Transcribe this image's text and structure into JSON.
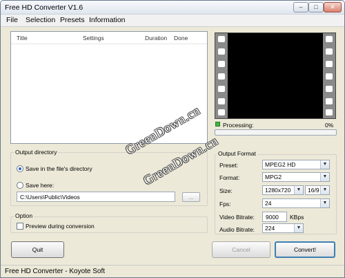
{
  "window": {
    "title": "Free HD Converter V1.6"
  },
  "menu": {
    "items": [
      "File",
      "Selection",
      "Presets",
      "Information"
    ]
  },
  "queue": {
    "columns": [
      "Title",
      "Settings",
      "Duration",
      "Done"
    ]
  },
  "preview": {
    "processing_label": "Processing:",
    "processing_pct": "0%",
    "progress": 0
  },
  "output_directory": {
    "title": "Output directory",
    "option_same": "Save in the file's directory",
    "option_here": "Save here:",
    "path": "C:\\Users\\Public\\Videos",
    "browse_label": "...",
    "selected": "same"
  },
  "option": {
    "title": "Option",
    "preview_label": "Preview during conversion",
    "preview_checked": false
  },
  "output_format": {
    "title": "Output Format",
    "preset_label": "Preset:",
    "preset_value": "MPEG2 HD",
    "format_label": "Format:",
    "format_value": "MPG2",
    "size_label": "Size:",
    "size_value": "1280x720",
    "aspect_value": "16/9",
    "fps_label": "Fps:",
    "fps_value": "24",
    "vbitrate_label": "Video Bitrate:",
    "vbitrate_value": "9000",
    "vbitrate_unit": "KBps",
    "abitrate_label": "Audio Bitrate:",
    "abitrate_value": "224"
  },
  "buttons": {
    "quit": "Quit",
    "cancel": "Cancel",
    "convert": "Convert!"
  },
  "statusbar": {
    "text": "Free HD Converter - Koyote Soft"
  },
  "watermarks": [
    "GreenDown.cn",
    "GreenDown.cn"
  ],
  "colors": {
    "accent": "#3c7fb1",
    "progress_led": "#3fb73f"
  }
}
